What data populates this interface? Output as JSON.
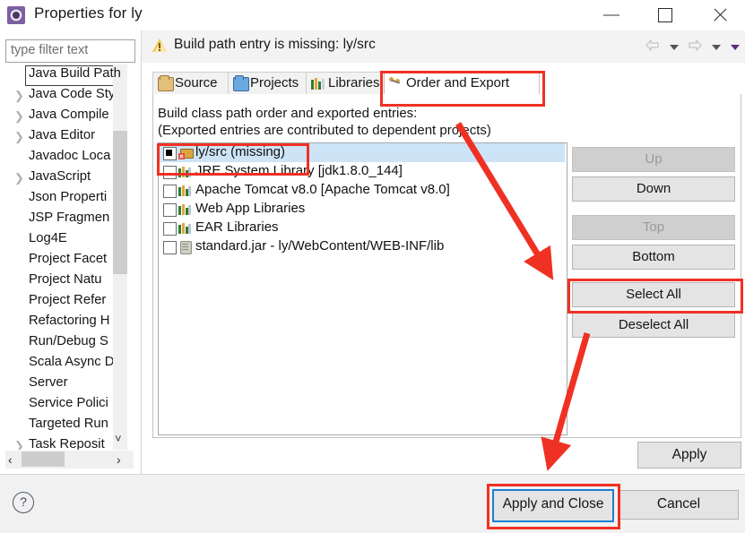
{
  "window": {
    "title": "Properties for ly",
    "app_icon": "properties-gear-icon",
    "minimize_label": "Minimize",
    "maximize_label": "Maximize",
    "close_label": "Close"
  },
  "sidebar": {
    "filter": {
      "placeholder": "type filter text",
      "value": ""
    },
    "items": [
      {
        "label": "Java Build Path",
        "expandable": false,
        "selected": true
      },
      {
        "label": "Java Code Sty",
        "expandable": true,
        "selected": false
      },
      {
        "label": "Java Compile",
        "expandable": true,
        "selected": false
      },
      {
        "label": "Java Editor",
        "expandable": true,
        "selected": false
      },
      {
        "label": "Javadoc Loca",
        "expandable": false,
        "selected": false
      },
      {
        "label": "JavaScript",
        "expandable": true,
        "selected": false
      },
      {
        "label": "Json Properti",
        "expandable": false,
        "selected": false
      },
      {
        "label": "JSP Fragmen",
        "expandable": false,
        "selected": false
      },
      {
        "label": "Log4E",
        "expandable": false,
        "selected": false
      },
      {
        "label": "Project Facet",
        "expandable": false,
        "selected": false
      },
      {
        "label": "Project Natu",
        "expandable": false,
        "selected": false
      },
      {
        "label": "Project Refer",
        "expandable": false,
        "selected": false
      },
      {
        "label": "Refactoring H",
        "expandable": false,
        "selected": false
      },
      {
        "label": "Run/Debug S",
        "expandable": false,
        "selected": false
      },
      {
        "label": "Scala Async D",
        "expandable": false,
        "selected": false
      },
      {
        "label": "Server",
        "expandable": false,
        "selected": false
      },
      {
        "label": "Service Polici",
        "expandable": false,
        "selected": false
      },
      {
        "label": "Targeted Run",
        "expandable": false,
        "selected": false
      },
      {
        "label": "Task Reposit",
        "expandable": true,
        "selected": false
      }
    ],
    "scroll_left_label": "‹",
    "scroll_right_label": "›",
    "scroll_down_label": "˅"
  },
  "message_bar": {
    "icon": "warning-icon",
    "text": "Build path entry is missing: ly/src"
  },
  "nav_toolbar": {
    "back": "back-arrow-icon",
    "back_menu": "chevron-down-icon",
    "forward": "forward-arrow-icon",
    "forward_menu": "chevron-down-icon",
    "view_menu": "chevron-down-icon"
  },
  "tabs": [
    {
      "label": "Source",
      "icon": "source-folder-icon",
      "active": false
    },
    {
      "label": "Projects",
      "icon": "projects-folder-icon",
      "active": false
    },
    {
      "label": "Libraries",
      "icon": "libraries-books-icon",
      "active": false
    },
    {
      "label": "Order and Export",
      "icon": "order-export-icon",
      "active": true
    }
  ],
  "content": {
    "heading": "Build class path order and exported entries:",
    "subheading": "(Exported entries are contributed to dependent projects)",
    "entries": [
      {
        "label": "ly/src (missing)",
        "icon": "package-error-icon",
        "checked": true,
        "selected": true,
        "strikethrough": false
      },
      {
        "label": "JRE System Library [jdk1.8.0_144]",
        "icon": "library-icon",
        "checked": false,
        "selected": false,
        "strikethrough": false
      },
      {
        "label": "Apache Tomcat v8.0 [Apache Tomcat v8.0]",
        "icon": "library-icon",
        "checked": false,
        "selected": false,
        "strikethrough": false
      },
      {
        "label": "Web App Libraries",
        "icon": "library-icon",
        "checked": false,
        "selected": false,
        "strikethrough": false
      },
      {
        "label": "EAR Libraries",
        "icon": "library-icon",
        "checked": false,
        "selected": false,
        "strikethrough": false
      },
      {
        "label": "standard.jar - ly/WebContent/WEB-INF/lib",
        "icon": "jar-icon",
        "checked": false,
        "selected": false,
        "strikethrough": false
      }
    ]
  },
  "side_buttons": [
    {
      "label": "Up",
      "enabled": false
    },
    {
      "label": "Down",
      "enabled": true
    },
    {
      "label": "Top",
      "enabled": false
    },
    {
      "label": "Bottom",
      "enabled": true
    },
    {
      "label": "Select All",
      "enabled": true
    },
    {
      "label": "Deselect All",
      "enabled": true
    }
  ],
  "footer": {
    "apply_label": "Apply",
    "help_label": "?",
    "apply_and_close_label": "Apply and Close",
    "cancel_label": "Cancel"
  },
  "annotations": {
    "color": "#ef3124",
    "highlight_tab": "Order and Export",
    "highlight_entry": "ly/src (missing)",
    "highlight_button": "Select All",
    "highlight_confirm": "Apply and Close",
    "arrow_count": 2
  }
}
